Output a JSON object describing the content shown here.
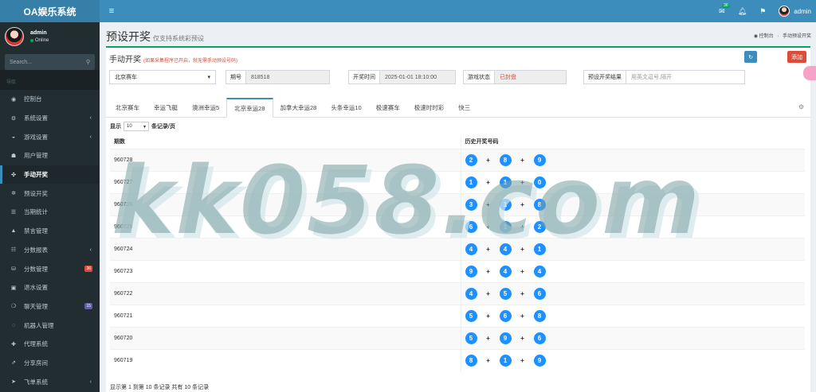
{
  "app": {
    "title": "OA娱乐系统"
  },
  "topbar": {
    "mail_badge": "36",
    "user": "admin"
  },
  "sidebar": {
    "user": {
      "name": "admin",
      "status": "Online"
    },
    "search_placeholder": "Search...",
    "header": "导航",
    "items": [
      {
        "label": "控制台",
        "icon": "dashboard-icon",
        "glyph": "◉",
        "arrow": false
      },
      {
        "label": "系统设置",
        "icon": "cogs-icon",
        "glyph": "⚙",
        "arrow": true
      },
      {
        "label": "游戏设置",
        "icon": "gamepad-icon",
        "glyph": "◒",
        "arrow": true
      },
      {
        "label": "用户管理",
        "icon": "users-icon",
        "glyph": "☗",
        "arrow": false
      },
      {
        "label": "手动开奖",
        "icon": "share-icon",
        "glyph": "✣",
        "arrow": false,
        "active": true
      },
      {
        "label": "预设开奖",
        "icon": "gear-icon",
        "glyph": "✲",
        "arrow": false
      },
      {
        "label": "当期统计",
        "icon": "list-icon",
        "glyph": "☰",
        "arrow": false
      },
      {
        "label": "禁言管理",
        "icon": "warning-icon",
        "glyph": "▲",
        "arrow": false
      },
      {
        "label": "分数报表",
        "icon": "list-ol-icon",
        "glyph": "☷",
        "arrow": true
      },
      {
        "label": "分数管理",
        "icon": "database-icon",
        "glyph": "⛁",
        "arrow": false,
        "badge": "36",
        "badge_color": "#dd4b39"
      },
      {
        "label": "退水设置",
        "icon": "money-icon",
        "glyph": "▣",
        "arrow": false
      },
      {
        "label": "聊天管理",
        "icon": "comments-icon",
        "glyph": "❍",
        "arrow": false,
        "badge": "15",
        "badge_color": "#605ca8"
      },
      {
        "label": "机器人管理",
        "icon": "comment-icon",
        "glyph": "◌",
        "arrow": false
      },
      {
        "label": "代理系统",
        "icon": "user-plus-icon",
        "glyph": "✚",
        "arrow": false
      },
      {
        "label": "分享房间",
        "icon": "share-square-icon",
        "glyph": "⇗",
        "arrow": false
      },
      {
        "label": "飞单系统",
        "icon": "paper-plane-icon",
        "glyph": "➤",
        "arrow": true
      }
    ]
  },
  "page": {
    "title": "预设开奖",
    "subtitle": "仅支持系统彩预设",
    "breadcrumb": [
      "控制台",
      "手动预设开奖"
    ]
  },
  "manual": {
    "title": "手动开奖",
    "hint": "(如果采集程序已开启，就无需手动预设号码)",
    "add_label": "添加",
    "lottery": "北京赛车",
    "period_label": "期号",
    "period_value": "818518",
    "time_label": "开奖时间",
    "time_value": "2025-01-01 18:10:00",
    "state_label": "游戏状态",
    "state_value": "已封盘",
    "result_label": "预设开奖结果",
    "result_placeholder": "用英文逗号,隔开"
  },
  "tabs": [
    "北京赛车",
    "幸运飞艇",
    "澳洲幸运5",
    "北京幸运28",
    "加拿大幸运28",
    "头条幸运10",
    "极速赛车",
    "极速时时彩",
    "快三"
  ],
  "active_tab": 3,
  "table": {
    "length_prefix": "显示",
    "length_value": "10",
    "length_suffix": "条记录/页",
    "columns": [
      "期数",
      "历史开奖号码"
    ],
    "rows": [
      {
        "period": "960728",
        "nums": [
          "2",
          "8",
          "9"
        ]
      },
      {
        "period": "960727",
        "nums": [
          "1",
          "1",
          "0"
        ]
      },
      {
        "period": "960726",
        "nums": [
          "3",
          "1",
          "8"
        ]
      },
      {
        "period": "960725",
        "nums": [
          "6",
          "1",
          "2"
        ]
      },
      {
        "period": "960724",
        "nums": [
          "4",
          "4",
          "1"
        ]
      },
      {
        "period": "960723",
        "nums": [
          "9",
          "4",
          "4"
        ]
      },
      {
        "period": "960722",
        "nums": [
          "4",
          "5",
          "6"
        ]
      },
      {
        "period": "960721",
        "nums": [
          "5",
          "6",
          "8"
        ]
      },
      {
        "period": "960720",
        "nums": [
          "5",
          "9",
          "6"
        ]
      },
      {
        "period": "960719",
        "nums": [
          "8",
          "1",
          "9"
        ]
      }
    ],
    "plus": "+",
    "info": "显示第 1 到第 10 条记录 共有 10 条记录"
  },
  "watermark": "kk058.com"
}
